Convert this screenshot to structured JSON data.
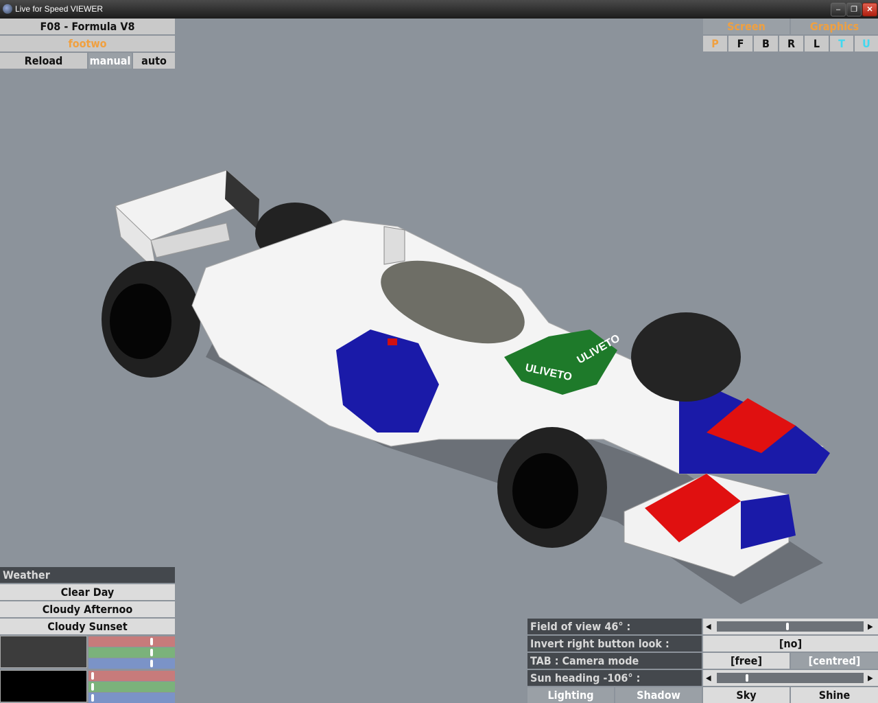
{
  "window": {
    "title": "Live for Speed VIEWER",
    "minimize": "–",
    "restore": "❐",
    "close": "✕"
  },
  "car_panel": {
    "car_name": "F08 - Formula V8",
    "skin_name": "footwo",
    "reload": "Reload",
    "manual": "manual",
    "auto": "auto"
  },
  "top_right": {
    "screen": "Screen",
    "graphics": "Graphics",
    "views": [
      "P",
      "F",
      "B",
      "R",
      "L",
      "T",
      "U"
    ]
  },
  "car_livery": {
    "sponsor_1": "ULIVETO",
    "sponsor_2": "ULIVETO"
  },
  "weather": {
    "title": "Weather",
    "options": [
      "Clear Day",
      "Cloudy Afternoo",
      "Cloudy Sunset"
    ],
    "colour_1": {
      "swatch": "#3c3c3c",
      "red": 0.75,
      "green": 0.75,
      "blue": 0.75
    },
    "colour_2": {
      "swatch": "#000000",
      "red": 0.03,
      "green": 0.03,
      "blue": 0.03
    }
  },
  "camera": {
    "fov_label": "Field of view 46° :",
    "fov_value": 0.48,
    "invert_label": "Invert right button look :",
    "invert_value": "[no]",
    "tab_label": "TAB : Camera mode",
    "mode_free": "[free]",
    "mode_centred": "[centred]",
    "sun_label": "Sun heading -106° :",
    "sun_value": 0.2,
    "tabs": [
      "Lighting",
      "Shadow",
      "Sky",
      "Shine"
    ],
    "left_arrow": "◀",
    "right_arrow": "▶"
  },
  "colors": {
    "red_slider": "#c77b7b",
    "green_slider": "#7bb27b",
    "blue_slider": "#7b93c7"
  }
}
